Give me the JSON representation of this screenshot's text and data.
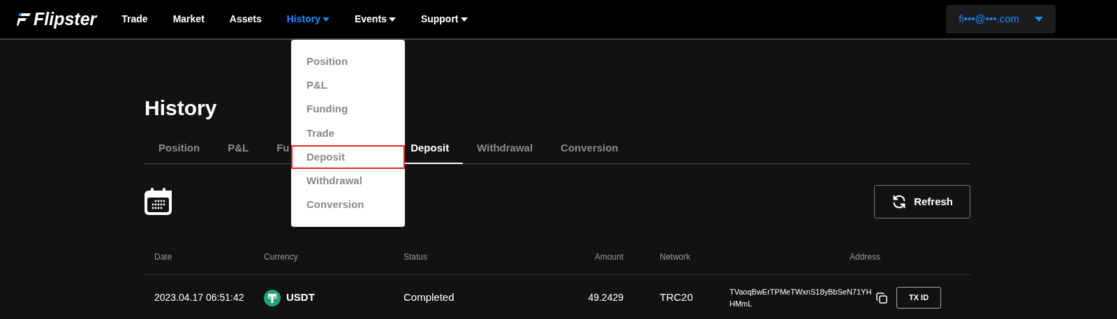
{
  "navbar": {
    "brand": "Flipster",
    "items": [
      {
        "label": "Trade",
        "selected": false,
        "dropdown": false
      },
      {
        "label": "Market",
        "selected": false,
        "dropdown": false
      },
      {
        "label": "Assets",
        "selected": false,
        "dropdown": false
      },
      {
        "label": "History",
        "selected": true,
        "dropdown": true
      },
      {
        "label": "Events",
        "selected": false,
        "dropdown": true
      },
      {
        "label": "Support",
        "selected": false,
        "dropdown": true
      }
    ],
    "account": "fi•••@•••.com"
  },
  "dropdown_menu": {
    "items": [
      {
        "label": "Position",
        "highlighted": false
      },
      {
        "label": "P&L",
        "highlighted": false
      },
      {
        "label": "Funding",
        "highlighted": false
      },
      {
        "label": "Trade",
        "highlighted": false
      },
      {
        "label": "Deposit",
        "highlighted": true
      },
      {
        "label": "Withdrawal",
        "highlighted": false
      },
      {
        "label": "Conversion",
        "highlighted": false
      }
    ]
  },
  "page_title": "History",
  "tabs": [
    {
      "label": "Position",
      "selected": false
    },
    {
      "label": "P&L",
      "selected": false
    },
    {
      "label": "Fu",
      "selected": false
    },
    {
      "label": "Deposit",
      "selected": true
    },
    {
      "label": "Withdrawal",
      "selected": false
    },
    {
      "label": "Conversion",
      "selected": false
    }
  ],
  "refresh_button": "Refresh",
  "table": {
    "columns": [
      "Date",
      "Currency",
      "Status",
      "Amount",
      "Network",
      "Address"
    ],
    "rows": [
      {
        "date": "2023.04.17 06:51:42",
        "currency": "USDT",
        "status": "Completed",
        "amount": "49.2429",
        "network": "TRC20",
        "address": "TVaoqBwErTPMeTWxnS18yBbSeN71YHHMmL",
        "action": "TX ID"
      }
    ]
  }
}
